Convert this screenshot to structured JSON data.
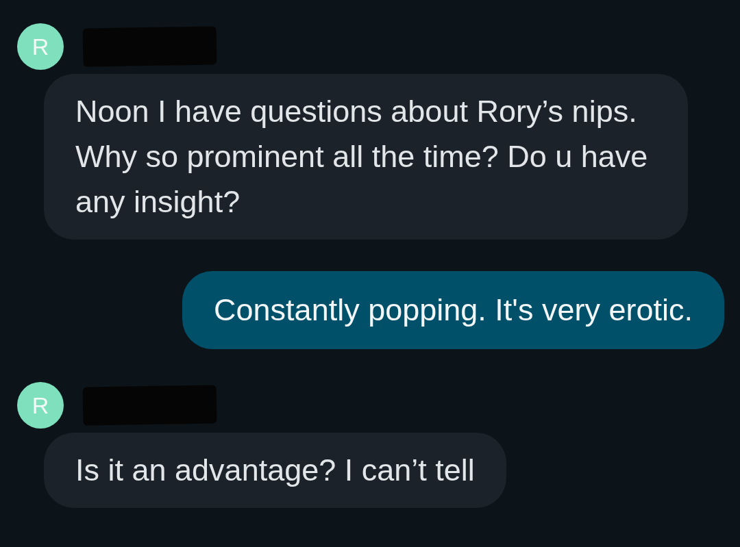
{
  "messages": [
    {
      "kind": "incoming",
      "avatar": "R",
      "color": "#7fe0bd",
      "sender_redacted": true,
      "text": "Noon I have questions about Rory’s nips. Why so prominent all the time? Do u have any insight?"
    },
    {
      "kind": "outgoing",
      "text": "Constantly popping. It's very erotic."
    },
    {
      "kind": "incoming",
      "avatar": "R",
      "color": "#7fe0bd",
      "sender_redacted": true,
      "text": "Is it an advantage? I can’t tell"
    }
  ]
}
